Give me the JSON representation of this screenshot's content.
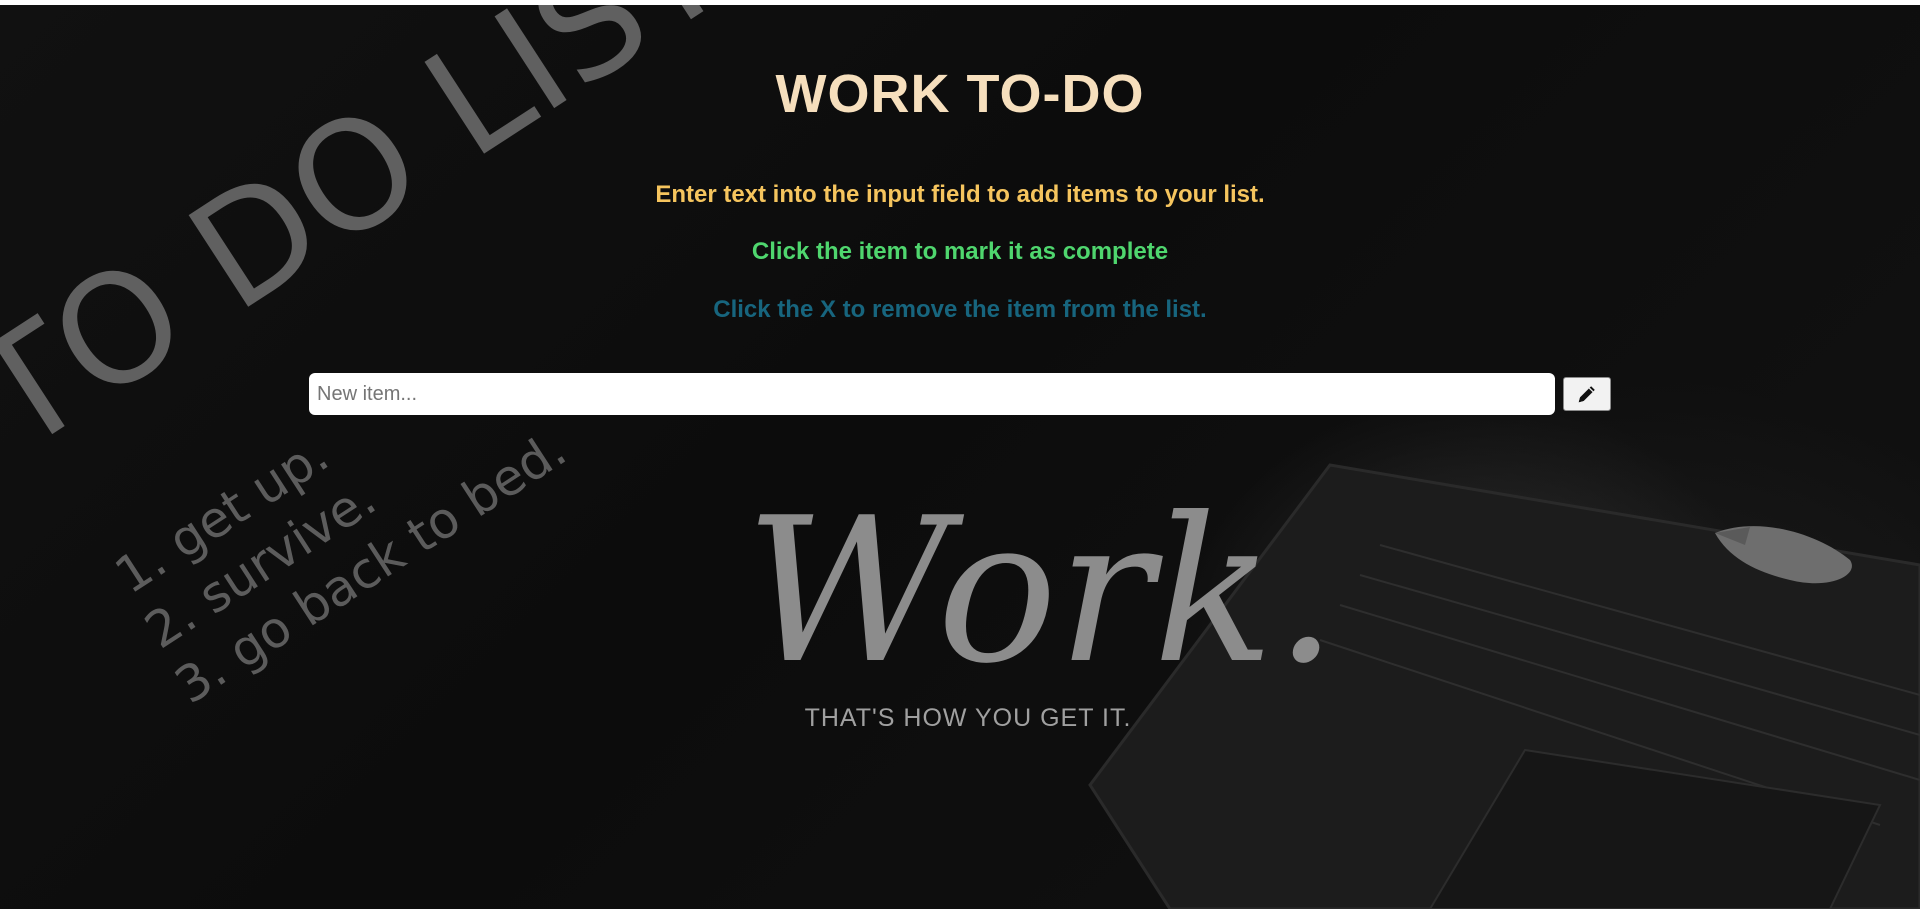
{
  "header": {
    "title": "WORK TO-DO"
  },
  "instructions": {
    "line1": "Enter text into the input field to add items to your list.",
    "line2": "Click the item to mark it as complete",
    "line3": "Click the X to remove the item from the list."
  },
  "form": {
    "placeholder": "New item...",
    "value": "",
    "submit_icon": "pencil-icon"
  },
  "background": {
    "doodle_heading": "TO DO LIST:",
    "doodle_items": [
      "1. get up.",
      "2. survive.",
      "3. go back to bed."
    ],
    "script_word": "Work.",
    "tagline": "THAT'S HOW YOU GET IT."
  },
  "colors": {
    "title": "#f6dfbd",
    "line1": "#f6c55e",
    "line2": "#4fd66e",
    "line3": "#17657e",
    "background": "#0e0e0e"
  }
}
